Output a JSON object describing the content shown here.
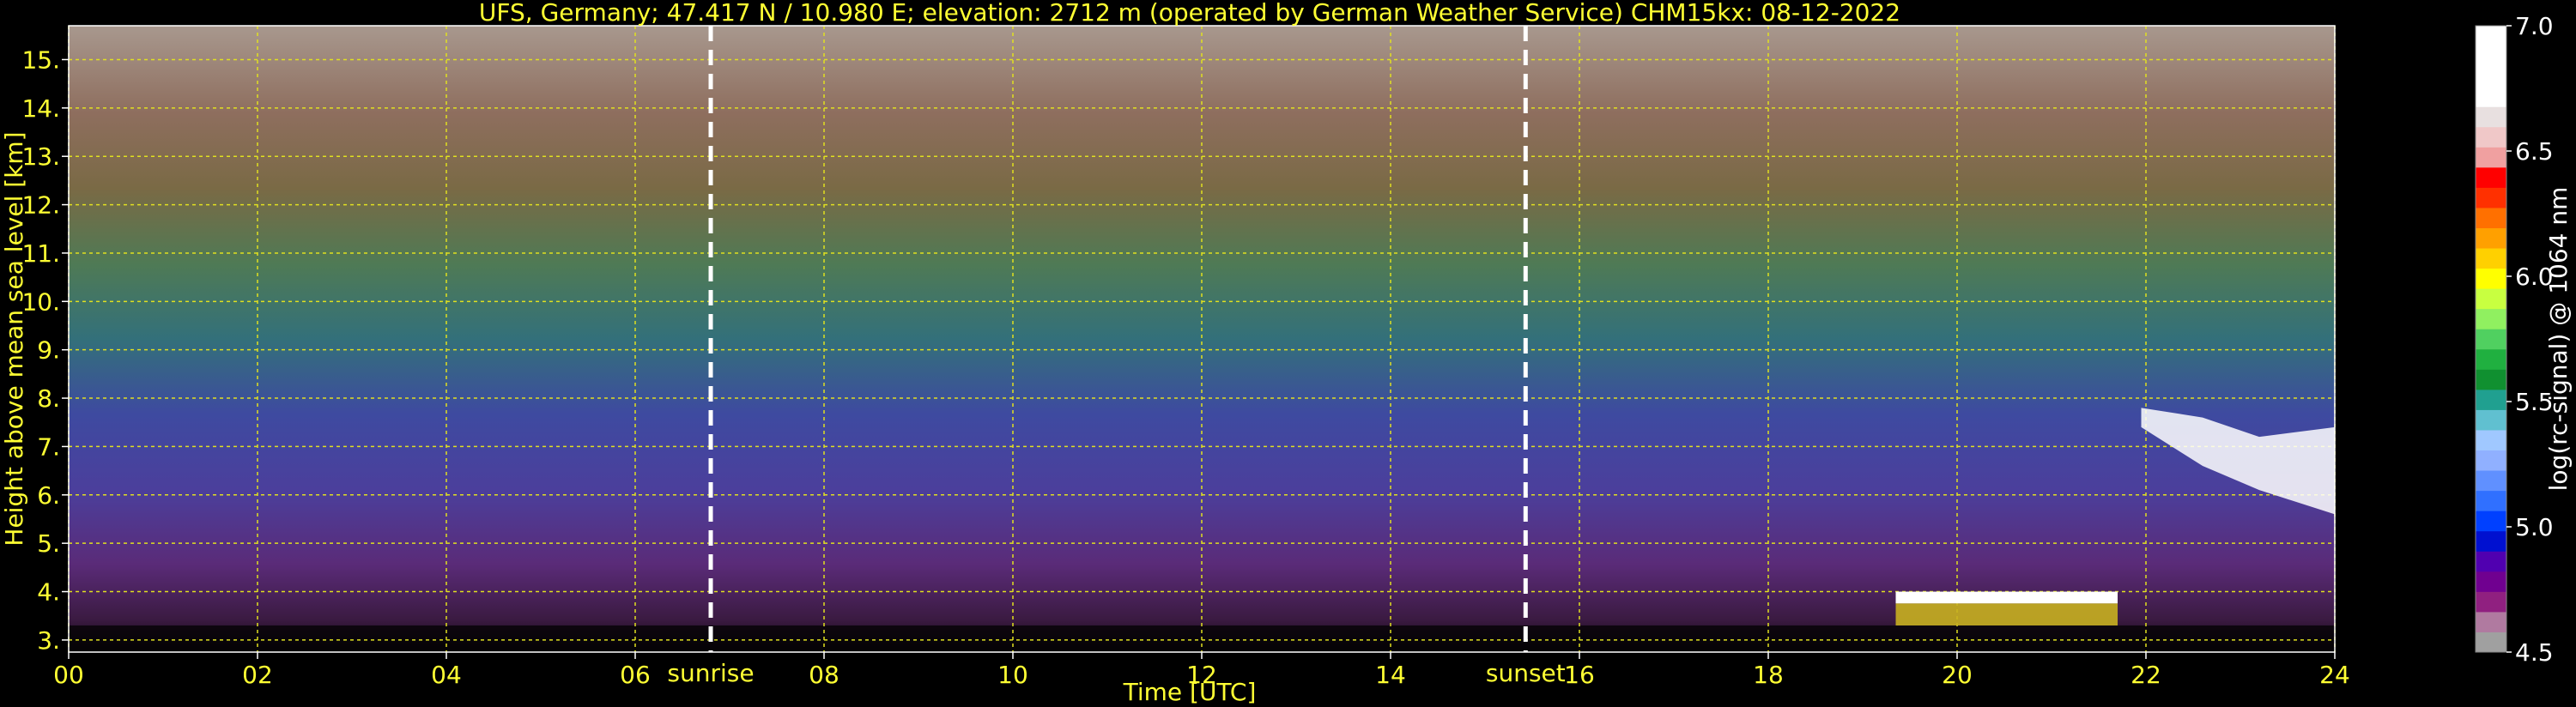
{
  "chart_data": {
    "type": "heatmap",
    "title": "UFS, Germany; 47.417 N / 10.980 E; elevation: 2712 m  (operated by German Weather Service)    CHM15kx: 08-12-2022",
    "xlabel": "Time [UTC]",
    "ylabel": "Height above mean sea level [km]",
    "xlim": [
      0,
      24
    ],
    "ylim": [
      2.75,
      15.7
    ],
    "x_ticks": [
      0,
      2,
      4,
      6,
      8,
      10,
      12,
      14,
      16,
      18,
      20,
      22,
      24
    ],
    "x_tick_labels": [
      "00",
      "02",
      "04",
      "06",
      "08",
      "10",
      "12",
      "14",
      "16",
      "18",
      "20",
      "22",
      "24"
    ],
    "y_ticks": [
      3,
      4,
      5,
      6,
      7,
      8,
      9,
      10,
      11,
      12,
      13,
      14,
      15
    ],
    "y_tick_labels": [
      "3.",
      "4.",
      "5.",
      "6.",
      "7.",
      "8.",
      "9.",
      "10.",
      "11.",
      "12.",
      "13.",
      "14.",
      "15."
    ],
    "grid": true,
    "markers": [
      {
        "label": "sunrise",
        "x": 6.8
      },
      {
        "label": "sunset",
        "x": 15.43
      }
    ],
    "colorbar": {
      "label": "log(rc-signal) @ 1064 nm",
      "range": [
        4.5,
        7.0
      ],
      "ticks": [
        4.5,
        5.0,
        5.5,
        6.0,
        6.5,
        7.0
      ],
      "tick_labels": [
        "4.5",
        "5.0",
        "5.5",
        "6.0",
        "6.5",
        "7.0"
      ],
      "colors": [
        "#a0a0a0",
        "#b07aa0",
        "#902080",
        "#700090",
        "#5000b0",
        "#0010d0",
        "#0040ff",
        "#3070ff",
        "#6090ff",
        "#90b0ff",
        "#a0c8ff",
        "#60c0d0",
        "#20a090",
        "#109030",
        "#20b040",
        "#50d060",
        "#90f060",
        "#c8ff40",
        "#ffff00",
        "#ffd000",
        "#ffa000",
        "#ff7000",
        "#ff3000",
        "#ff0000",
        "#f0a0a0",
        "#f0c8c8",
        "#e8e0e0",
        "#ffffff",
        "#ffffff",
        "#ffffff",
        "#ffffff"
      ]
    },
    "features": [
      {
        "name": "cloud-low",
        "x_range": [
          19.35,
          21.7
        ],
        "y_range": [
          3.3,
          4.0
        ]
      },
      {
        "name": "cloud-mid",
        "x_range": [
          21.95,
          24.0
        ],
        "y_range": [
          5.6,
          7.8
        ]
      }
    ]
  }
}
